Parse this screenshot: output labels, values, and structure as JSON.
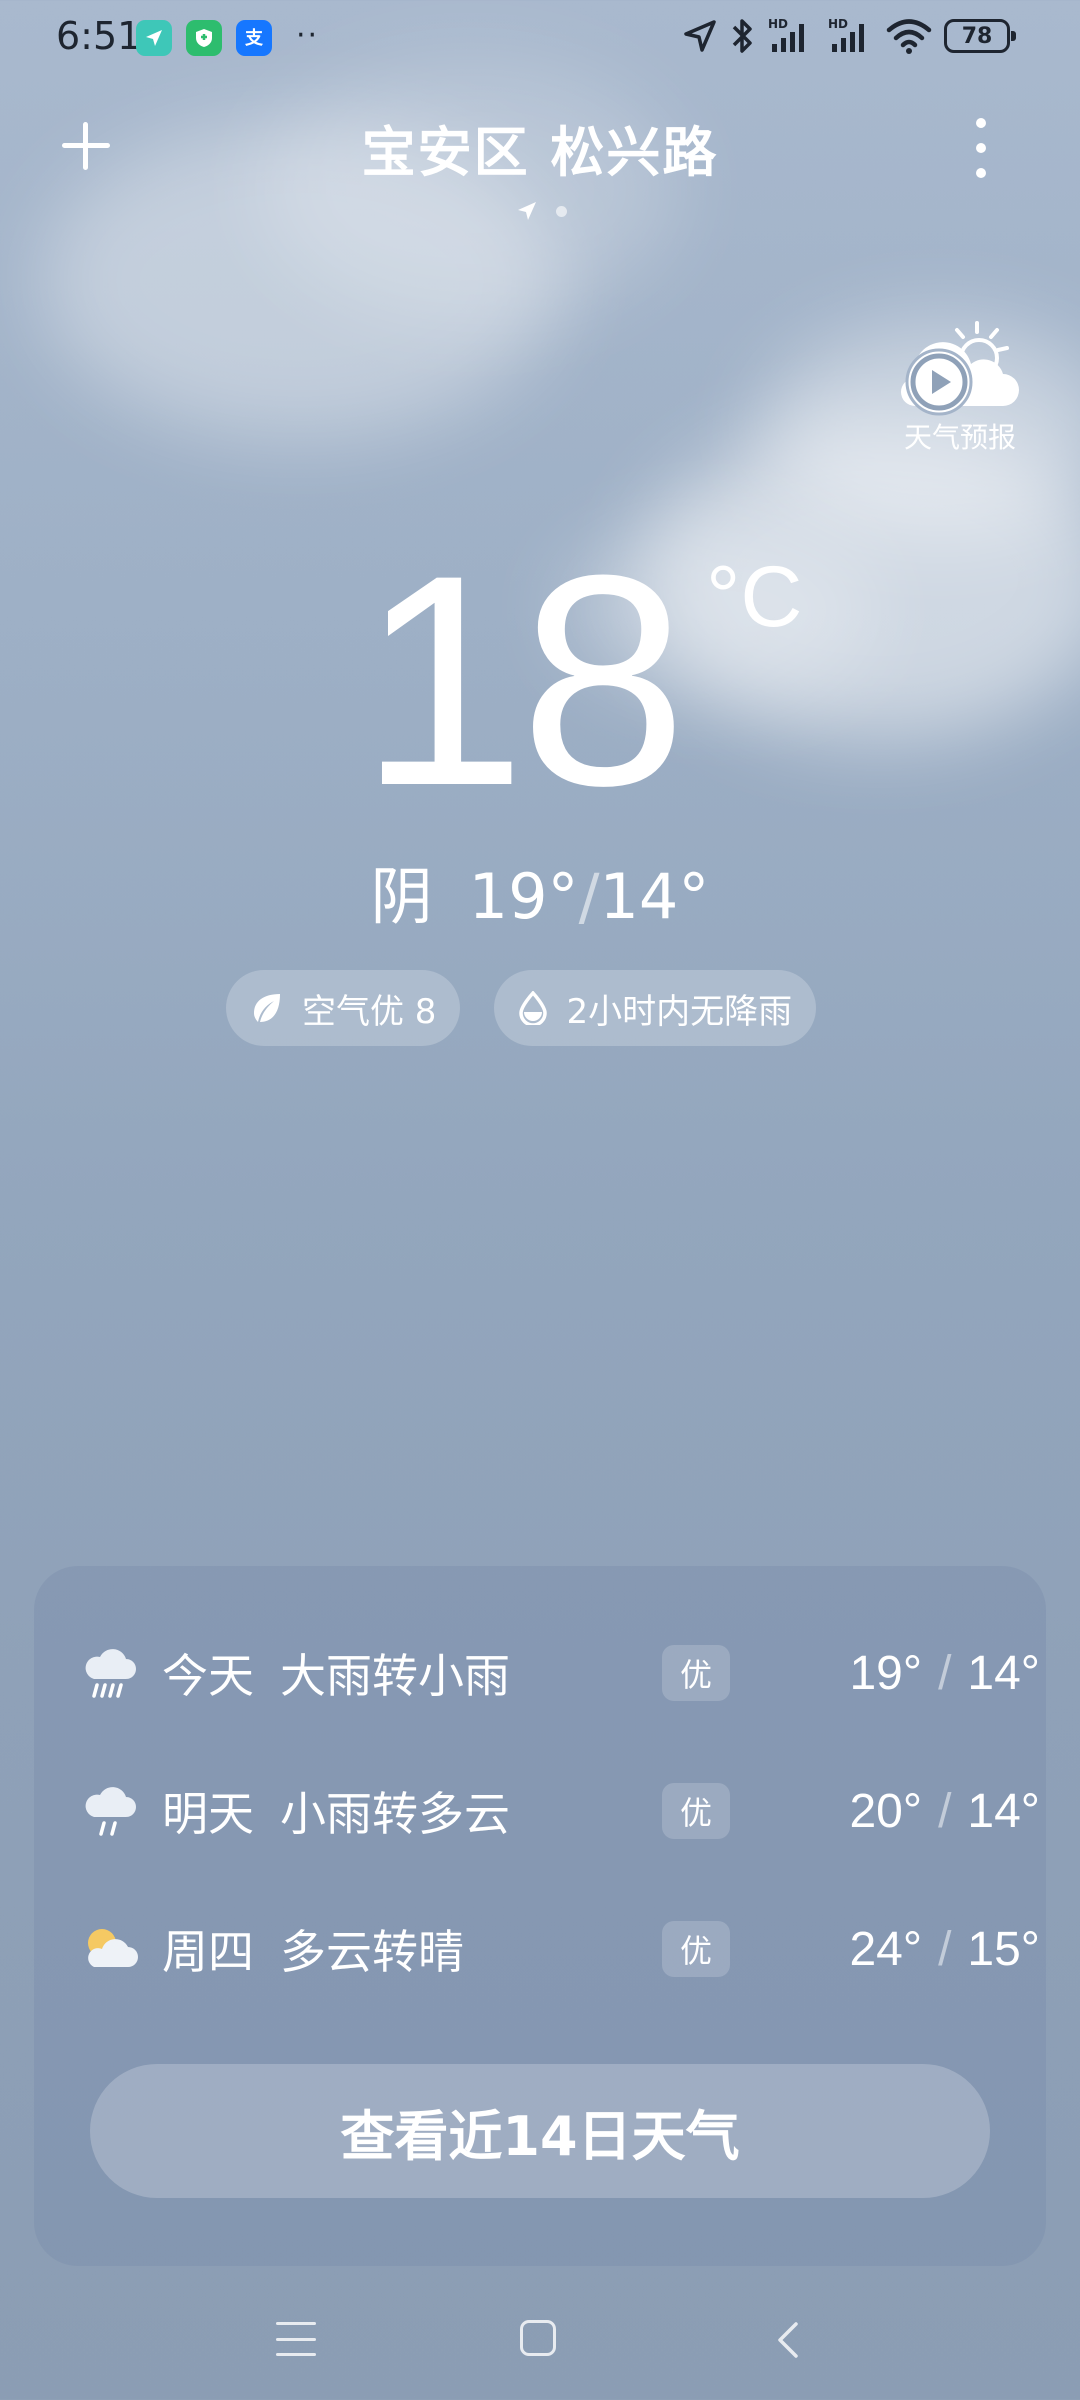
{
  "status_bar": {
    "time": "6:51",
    "dots": "··",
    "battery": "78",
    "hd1": "HD",
    "hd2": "HD"
  },
  "header": {
    "location": "宝安区 松兴路"
  },
  "forecast_video": {
    "label": "天气预报"
  },
  "current": {
    "temperature": "18",
    "unit": "°C",
    "condition": "阴",
    "high": "19°",
    "low": "14°",
    "separator": "/"
  },
  "chips": {
    "air_quality": "空气优 8",
    "precip": "2小时内无降雨"
  },
  "forecast": [
    {
      "day": "今天",
      "desc": "大雨转小雨",
      "aqi": "优",
      "high": "19°",
      "low": "14°",
      "icon": "heavy-rain-icon"
    },
    {
      "day": "明天",
      "desc": "小雨转多云",
      "aqi": "优",
      "high": "20°",
      "low": "14°",
      "icon": "light-rain-icon"
    },
    {
      "day": "周四",
      "desc": "多云转晴",
      "aqi": "优",
      "high": "24°",
      "low": "15°",
      "icon": "partly-cloudy-icon"
    }
  ],
  "forecast_slash": "/",
  "button_14day": "查看近14日天气",
  "colors": {
    "status_text": "#1e2530",
    "accent_sun": "#f5c963"
  }
}
